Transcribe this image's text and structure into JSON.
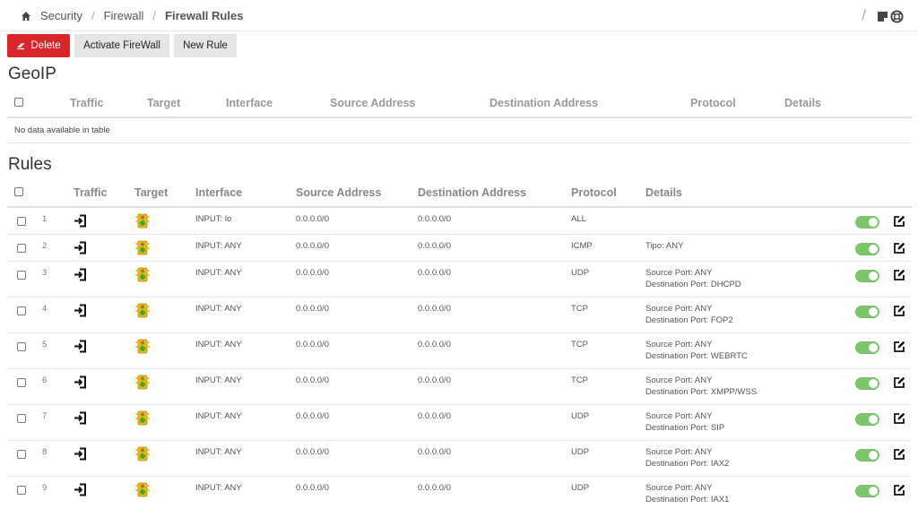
{
  "breadcrumb": {
    "items": [
      "Security",
      "Firewall",
      "Firewall Rules"
    ]
  },
  "toolbar": {
    "delete_label": "Delete",
    "activate_label": "Activate FireWall",
    "new_rule_label": "New Rule"
  },
  "geoip": {
    "title": "GeoIP",
    "columns": [
      "Traffic",
      "Target",
      "Interface",
      "Source Address",
      "Destination Address",
      "Protocol",
      "Details"
    ],
    "empty_text": "No data available in table"
  },
  "rules": {
    "title": "Rules",
    "columns": [
      "Traffic",
      "Target",
      "Interface",
      "Source Address",
      "Destination Address",
      "Protocol",
      "Details"
    ],
    "rows": [
      {
        "num": "1",
        "interface": "INPUT: lo",
        "source": "0.0.0.0/0",
        "destination": "0.0.0.0/0",
        "protocol": "ALL",
        "details": [
          "",
          ""
        ],
        "enabled": true
      },
      {
        "num": "2",
        "interface": "INPUT: ANY",
        "source": "0.0.0.0/0",
        "destination": "0.0.0.0/0",
        "protocol": "ICMP",
        "details": [
          "Tipo: ANY",
          ""
        ],
        "enabled": true
      },
      {
        "num": "3",
        "interface": "INPUT: ANY",
        "source": "0.0.0.0/0",
        "destination": "0.0.0.0/0",
        "protocol": "UDP",
        "details": [
          "Source Port: ANY",
          "Destination Port: DHCPD"
        ],
        "enabled": true
      },
      {
        "num": "4",
        "interface": "INPUT: ANY",
        "source": "0.0.0.0/0",
        "destination": "0.0.0.0/0",
        "protocol": "TCP",
        "details": [
          "Source Port: ANY",
          "Destination Port: FOP2"
        ],
        "enabled": true
      },
      {
        "num": "5",
        "interface": "INPUT: ANY",
        "source": "0.0.0.0/0",
        "destination": "0.0.0.0/0",
        "protocol": "TCP",
        "details": [
          "Source Port: ANY",
          "Destination Port: WEBRTC"
        ],
        "enabled": true
      },
      {
        "num": "6",
        "interface": "INPUT: ANY",
        "source": "0.0.0.0/0",
        "destination": "0.0.0.0/0",
        "protocol": "TCP",
        "details": [
          "Source Port: ANY",
          "Destination Port: XMPP/WSS"
        ],
        "enabled": true
      },
      {
        "num": "7",
        "interface": "INPUT: ANY",
        "source": "0.0.0.0/0",
        "destination": "0.0.0.0/0",
        "protocol": "UDP",
        "details": [
          "Source Port: ANY",
          "Destination Port: SIP"
        ],
        "enabled": true
      },
      {
        "num": "8",
        "interface": "INPUT: ANY",
        "source": "0.0.0.0/0",
        "destination": "0.0.0.0/0",
        "protocol": "UDP",
        "details": [
          "Source Port: ANY",
          "Destination Port: IAX2"
        ],
        "enabled": true
      },
      {
        "num": "9",
        "interface": "INPUT: ANY",
        "source": "0.0.0.0/0",
        "destination": "0.0.0.0/0",
        "protocol": "UDP",
        "details": [
          "Source Port: ANY",
          "Destination Port: IAX1"
        ],
        "enabled": true
      }
    ]
  },
  "icons": {
    "home": "home-icon",
    "notes": "notes-icon",
    "help": "lifebuoy-icon",
    "eraser": "eraser-icon",
    "traffic": "sign-in-icon",
    "target": "traffic-light-icon",
    "edit": "edit-icon"
  },
  "colors": {
    "delete": "#d9262b",
    "toggle_on": "#7cc56a",
    "target_green": "#44aa22"
  }
}
